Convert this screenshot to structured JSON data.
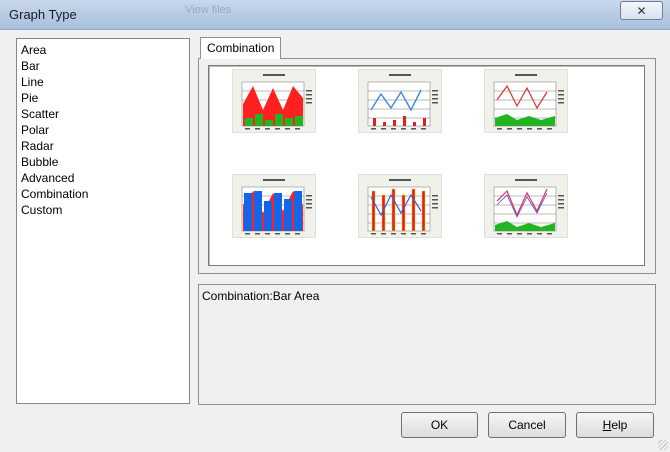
{
  "window": {
    "title": "Graph Type",
    "close_glyph": "✕",
    "background_text": "View files"
  },
  "type_list": {
    "items": [
      "Area",
      "Bar",
      "Line",
      "Pie",
      "Scatter",
      "Polar",
      "Radar",
      "Bubble",
      "Advanced",
      "Combination",
      "Custom"
    ],
    "selected": "Combination"
  },
  "tabs": [
    {
      "label": "Combination"
    }
  ],
  "gallery": {
    "thumbnails": [
      {
        "name": "area-bar-combo",
        "style": "area-bar",
        "colors": {
          "primary": "#ff2020",
          "secondary": "#22b422"
        }
      },
      {
        "name": "line-bar-combo",
        "style": "line-bar",
        "colors": {
          "primary": "#3b8be0",
          "secondary": "#e02020"
        }
      },
      {
        "name": "line-area-combo",
        "style": "line-area",
        "colors": {
          "primary": "#e03030",
          "secondary": "#22b422"
        }
      },
      {
        "name": "bar-area-combo",
        "style": "bar-area",
        "colors": {
          "primary": "#1565e8",
          "secondary": "#ff2020"
        }
      },
      {
        "name": "bar-line-combo",
        "style": "bar-line",
        "colors": {
          "primary": "#e02020",
          "secondary": "#3b5bd8"
        }
      },
      {
        "name": "line-area-blue-combo",
        "style": "line-area2",
        "colors": {
          "primary": "#e03060",
          "secondary": "#22b422"
        }
      }
    ]
  },
  "description": "Combination:Bar Area",
  "buttons": {
    "ok": "OK",
    "cancel": "Cancel",
    "help_prefix": "H",
    "help_rest": "elp"
  }
}
